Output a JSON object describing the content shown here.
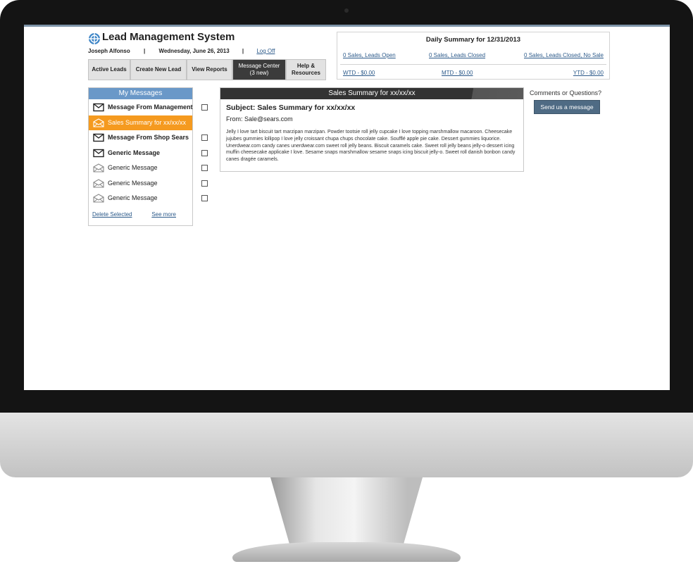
{
  "app": {
    "title": "Lead Management System",
    "user": "Joseph Alfonso",
    "separator": "|",
    "date": "Wednesday, June 26, 2013",
    "logout": "Log Off"
  },
  "nav": {
    "tabs": [
      {
        "label": "Active Leads"
      },
      {
        "label": "Create New Lead"
      },
      {
        "label": "View Reports"
      },
      {
        "label": "Message Center",
        "sub": "(3 new)"
      },
      {
        "label": "Help &",
        "sub": "Resources"
      }
    ]
  },
  "summary": {
    "title": "Daily Summary for 12/31/2013",
    "leads_open": "0 Sales, Leads Open",
    "leads_closed": "0 Sales, Leads Closed",
    "leads_closed_no_sale": "0 Sales, Leads Closed, No Sale",
    "wtd": "WTD - $0.00",
    "mtd": "MTD - $0.00",
    "ytd": "YTD - $0.00"
  },
  "messages": {
    "title": "My Messages",
    "items": [
      {
        "label": "Message From Management",
        "status": "unread"
      },
      {
        "label": "Sales Summary for xx/xx/xx",
        "status": "selected"
      },
      {
        "label": "Message From Shop Sears",
        "status": "unread"
      },
      {
        "label": "Generic Message",
        "status": "unread"
      },
      {
        "label": "Generic Message",
        "status": "read"
      },
      {
        "label": "Generic Message",
        "status": "read"
      },
      {
        "label": "Generic Message",
        "status": "read"
      }
    ],
    "delete_selected": "Delete Selected",
    "see_more": "See more"
  },
  "detail": {
    "header": "Sales Summary for xx/xx/xx",
    "subject": "Subject: Sales Summary for xx/xx/xx",
    "from": "From: Sale@sears.com",
    "body": "Jelly I love tart biscuit tart marzipan marzipan. Powder tootsie roll jelly cupcake I love topping marshmallow macaroon. Cheesecake jujubes gummies lollipop I love jelly croissant chupa chups chocolate cake. Soufflé apple pie cake. Dessert gummies liquorice. Unerdwear.com candy canes unerdwear.com sweet roll jelly beans. Biscuit caramels cake. Sweet roll jelly beans jelly-o dessert icing muffin cheesecake applicake I love. Sesame snaps marshmallow sesame snaps icing biscuit jelly-o. Sweet roll danish bonbon candy canes dragée caramels."
  },
  "sidebar": {
    "comments": "Comments or Questions?",
    "send_button": "Send us a message"
  },
  "colors": {
    "accent_blue": "#6a98c8",
    "selected_orange": "#f59a1f",
    "link_blue": "#2c5a8a",
    "button_slate": "#4f6b84",
    "active_tab": "#3b3b3b"
  }
}
